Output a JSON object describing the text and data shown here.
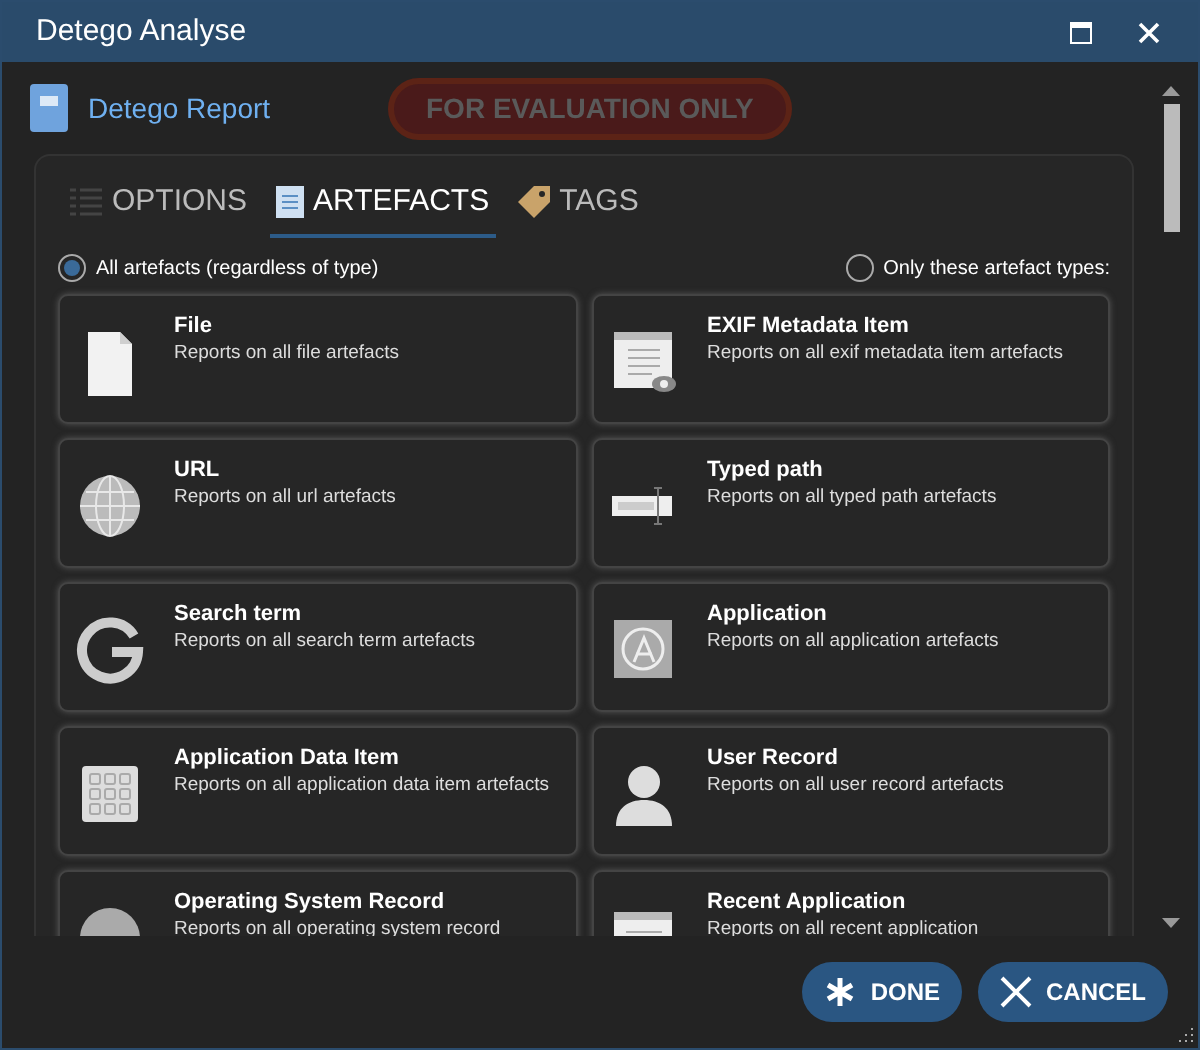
{
  "window": {
    "title": "Detego Analyse"
  },
  "header": {
    "title": "Detego Report",
    "badge": "FOR EVALUATION ONLY"
  },
  "tabs": [
    {
      "label": "OPTIONS",
      "selected": false
    },
    {
      "label": "ARTEFACTS",
      "selected": true
    },
    {
      "label": "TAGS",
      "selected": false
    }
  ],
  "scope": [
    {
      "label": "All artefacts (regardless of type)",
      "selected": true
    },
    {
      "label": "Only these artefact types:",
      "selected": false
    }
  ],
  "artefact_types": [
    {
      "title": "File",
      "description": "Reports on all file artefacts"
    },
    {
      "title": "EXIF Metadata Item",
      "description": "Reports on all exif metadata item artefacts"
    },
    {
      "title": "URL",
      "description": "Reports on all url artefacts"
    },
    {
      "title": "Typed path",
      "description": "Reports on all typed path artefacts"
    },
    {
      "title": "Search term",
      "description": "Reports on all search term artefacts"
    },
    {
      "title": "Application",
      "description": "Reports on all application artefacts"
    },
    {
      "title": "Application Data Item",
      "description": "Reports on all application data item artefacts"
    },
    {
      "title": "User Record",
      "description": "Reports on all user record artefacts"
    },
    {
      "title": "Operating System Record",
      "description": "Reports on all operating system record"
    },
    {
      "title": "Recent Application",
      "description": "Reports on all recent application"
    }
  ],
  "buttons": [
    {
      "label": "DONE",
      "kind": "done"
    },
    {
      "label": "CANCEL",
      "kind": "cancel"
    }
  ]
}
